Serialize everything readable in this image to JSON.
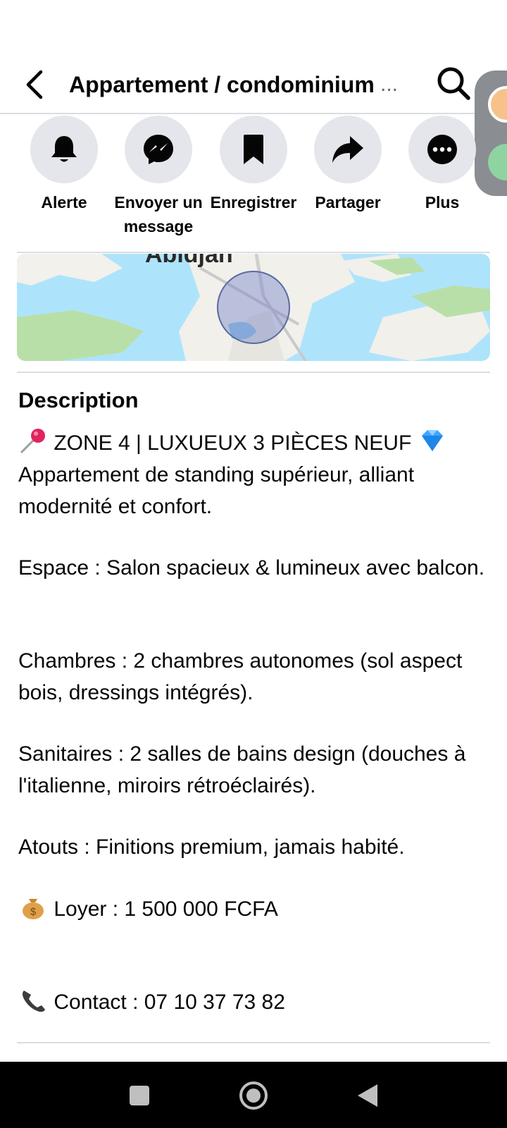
{
  "header": {
    "title": "Appartement / condominium",
    "ellipsis": "..."
  },
  "actions": [
    {
      "label": "Alerte",
      "icon": "bell-icon"
    },
    {
      "label": "Envoyer un message",
      "icon": "messenger-icon"
    },
    {
      "label": "Enregistrer",
      "icon": "bookmark-icon"
    },
    {
      "label": "Partager",
      "icon": "share-icon"
    },
    {
      "label": "Plus",
      "icon": "more-icon"
    }
  ],
  "map": {
    "city_label": "Abidjan"
  },
  "description": {
    "title": "Description",
    "headline": "ZONE 4 | LUXUEUX 3 PIÈCES NEUF",
    "intro": "Appartement de standing supérieur, alliant modernité et confort.",
    "espace": "Espace : Salon spacieux & lumineux avec balcon.",
    "chambres": "Chambres : 2 chambres autonomes (sol aspect bois, dressings intégrés).",
    "sanitaires": "Sanitaires : 2 salles de bains design (douches à l'italienne, miroirs rétroéclairés).",
    "atouts": "Atouts : Finitions premium, jamais habité.",
    "loyer": "Loyer : 1 500 000 FCFA",
    "contact": "Contact : 07 10 37 73 82"
  },
  "colors": {
    "icon_circle_bg": "#e4e6eb",
    "divider": "#dadde1",
    "text": "#050505",
    "nav_bar": "#000000"
  }
}
